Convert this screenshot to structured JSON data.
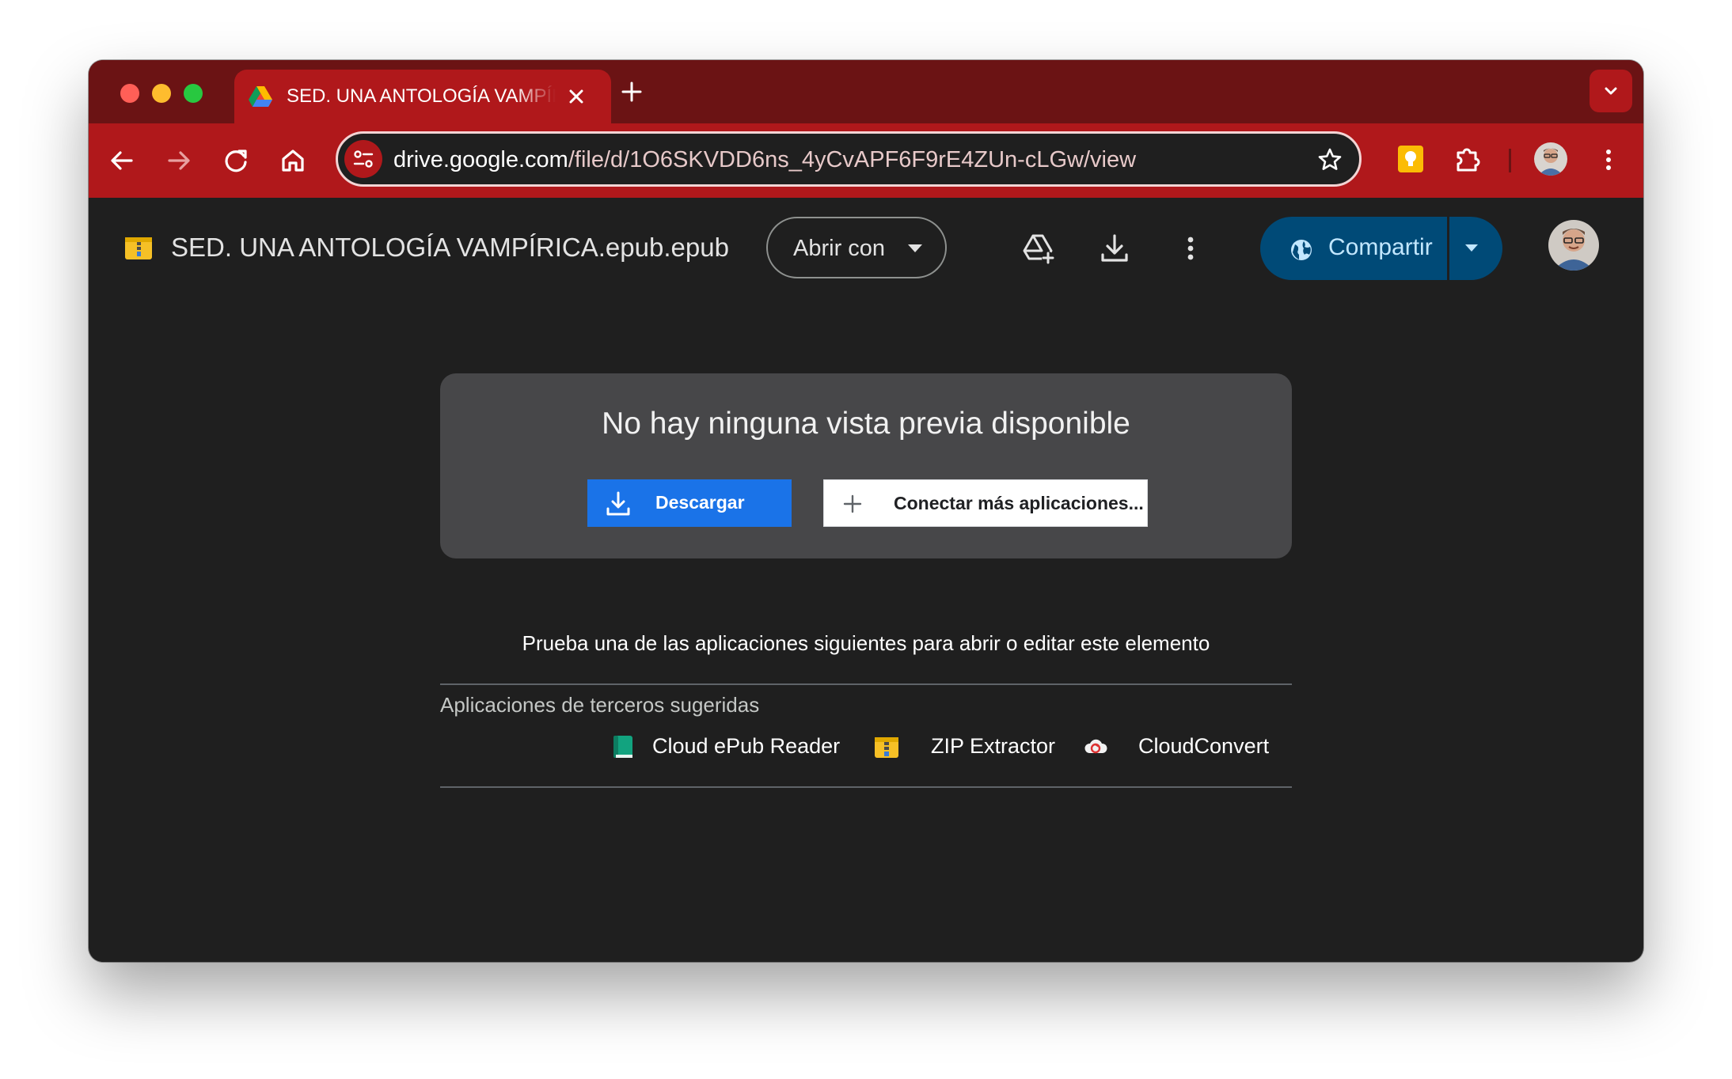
{
  "browser": {
    "tab": {
      "title": "SED. UNA ANTOLOGÍA VAMPÍRICA.epub.epub"
    },
    "omnibox": {
      "url_host": "drive.google.com",
      "url_path": "/file/d/1O6SKVDD6ns_4yCvAPF6F9rE4ZUn-cLGw/view"
    },
    "colors": {
      "frame": "#6b1314",
      "toolbar": "#b0181b"
    }
  },
  "drive": {
    "file_title": "SED. UNA ANTOLOGÍA VAMPÍRICA.epub.epub",
    "open_with_label": "Abrir con",
    "share_label": "Compartir"
  },
  "preview": {
    "message": "No hay ninguna vista previa disponible",
    "download_label": "Descargar",
    "connect_label": "Conectar más aplicaciones..."
  },
  "suggestions": {
    "prompt": "Prueba una de las aplicaciones siguientes para abrir o editar este elemento",
    "section_title": "Aplicaciones de terceros sugeridas",
    "apps": [
      {
        "label": "Cloud ePub Reader",
        "icon": "ebook-reader-icon"
      },
      {
        "label": "ZIP Extractor",
        "icon": "zip-extractor-icon"
      },
      {
        "label": "CloudConvert",
        "icon": "cloudconvert-icon"
      }
    ]
  }
}
